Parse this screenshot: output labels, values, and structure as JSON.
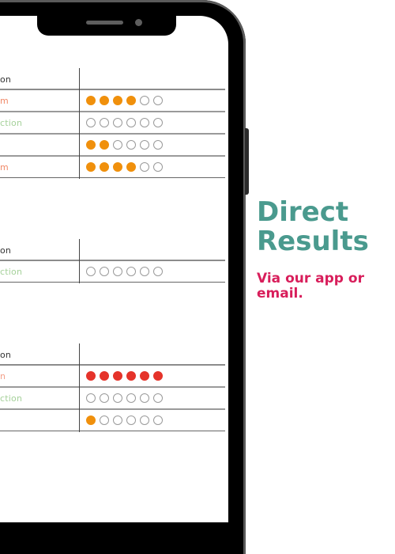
{
  "promo": {
    "headline_line1": "Direct",
    "headline_line2": "Results",
    "subline_line1": "Via our app or",
    "subline_line2": "email.",
    "headline_color": "#4a9a8e",
    "subline_color": "#d81e5b"
  },
  "colors": {
    "filled_orange": "#f0900c",
    "filled_red": "#e5332a",
    "empty_outline": "#9a9a9a"
  },
  "tables": [
    {
      "header": "on",
      "rows": [
        {
          "label": "m",
          "label_color": "#f08a6a",
          "filled": 4,
          "total": 6,
          "fill": "orange"
        },
        {
          "label": "ction",
          "label_color": "#a5d19a",
          "filled": 0,
          "total": 6,
          "fill": "orange"
        },
        {
          "label": "",
          "label_color": "#f3a0b0",
          "filled": 2,
          "total": 6,
          "fill": "orange"
        },
        {
          "label": "m",
          "label_color": "#f08a6a",
          "filled": 4,
          "total": 6,
          "fill": "orange"
        }
      ]
    },
    {
      "header": "on",
      "rows": [
        {
          "label": "ction",
          "label_color": "#a5d19a",
          "filled": 0,
          "total": 6,
          "fill": "orange"
        }
      ]
    },
    {
      "header": "on",
      "rows": [
        {
          "label": "n",
          "label_color": "#f3a08a",
          "filled": 6,
          "total": 6,
          "fill": "red"
        },
        {
          "label": "ction",
          "label_color": "#a5d19a",
          "filled": 0,
          "total": 6,
          "fill": "orange"
        },
        {
          "label": "",
          "label_color": "#f3a0b0",
          "filled": 1,
          "total": 6,
          "fill": "orange"
        }
      ]
    }
  ]
}
